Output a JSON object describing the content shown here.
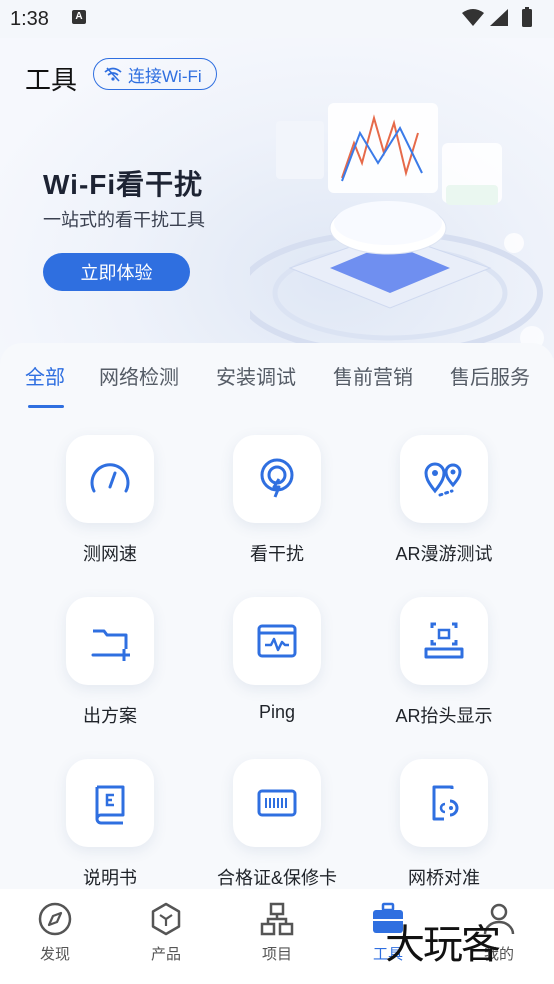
{
  "status": {
    "time": "1:38",
    "a_badge": "A"
  },
  "header": {
    "title": "工具",
    "wifi_chip": "连接Wi-Fi"
  },
  "banner": {
    "title": "Wi-Fi看干扰",
    "subtitle": "一站式的看干扰工具",
    "cta": "立即体验"
  },
  "tabs": [
    "全部",
    "网络检测",
    "安装调试",
    "售前营销",
    "售后服务"
  ],
  "tools": [
    {
      "label": "测网速",
      "icon": "speedometer-icon"
    },
    {
      "label": "看干扰",
      "icon": "signal-interference-icon"
    },
    {
      "label": "AR漫游测试",
      "icon": "location-pins-icon"
    },
    {
      "label": "出方案",
      "icon": "folder-add-icon"
    },
    {
      "label": "Ping",
      "icon": "ping-monitor-icon"
    },
    {
      "label": "AR抬头显示",
      "icon": "ar-scan-icon"
    },
    {
      "label": "说明书",
      "icon": "manual-book-icon"
    },
    {
      "label": "合格证&保修卡",
      "icon": "barcode-card-icon"
    },
    {
      "label": "网桥对准",
      "icon": "bridge-align-icon"
    }
  ],
  "nav": [
    {
      "label": "发现",
      "icon": "compass-icon"
    },
    {
      "label": "产品",
      "icon": "product-hex-icon"
    },
    {
      "label": "项目",
      "icon": "project-tree-icon"
    },
    {
      "label": "工具",
      "icon": "toolbox-icon",
      "active": true
    },
    {
      "label": "我的",
      "icon": "user-icon"
    }
  ],
  "watermark": "大玩客",
  "colors": {
    "accent": "#2f6fe0",
    "background": "#f4f7fb"
  }
}
